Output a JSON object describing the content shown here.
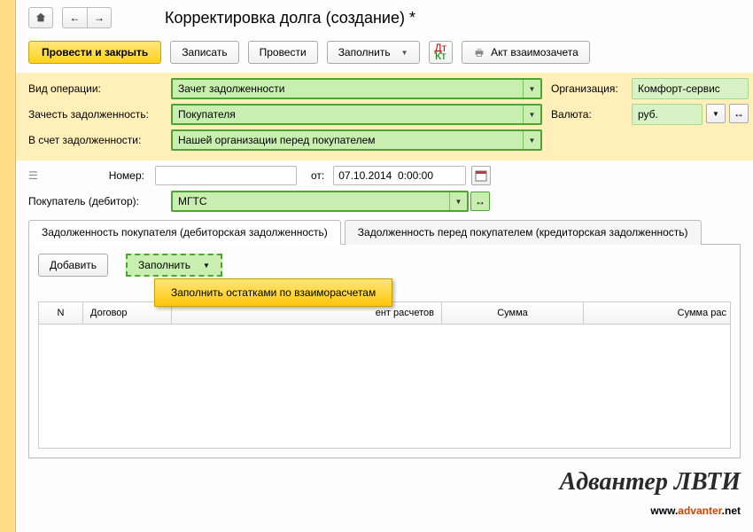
{
  "title": "Корректировка долга (создание) *",
  "toolbar": {
    "post_and_close": "Провести и закрыть",
    "save": "Записать",
    "post": "Провести",
    "fill": "Заполнить",
    "act": "Акт взаимозачета"
  },
  "form": {
    "op_type_label": "Вид операции:",
    "op_type_value": "Зачет задолженности",
    "offset_debt_label": "Зачесть задолженность:",
    "offset_debt_value": "Покупателя",
    "against_debt_label": "В счет задолженности:",
    "against_debt_value": "Нашей организации перед покупателем",
    "org_label": "Организация:",
    "org_value": "Комфорт-сервис",
    "currency_label": "Валюта:",
    "currency_value": "руб."
  },
  "doc": {
    "number_label": "Номер:",
    "number_value": "",
    "from_label": "от:",
    "date_value": "07.10.2014  0:00:00",
    "buyer_label": "Покупатель (дебитор):",
    "buyer_value": "МГТС"
  },
  "tabs": {
    "tab1": "Задолженность покупателя (дебиторская задолженность)",
    "tab2": "Задолженность перед покупателем (кредиторская задолженность)"
  },
  "tab_toolbar": {
    "add": "Добавить",
    "fill": "Заполнить"
  },
  "popup_item": "Заполнить остатками по взаиморасчетам",
  "table": {
    "col_n": "N",
    "col_contract": "Договор",
    "col_settle_doc": "ент расчетов",
    "col_amount": "Сумма",
    "col_amount_calc": "Сумма рас"
  },
  "watermark": {
    "line1": "Адвантер ЛВТИ",
    "www": "www.",
    "accent": "advanter",
    "net": ".net"
  }
}
